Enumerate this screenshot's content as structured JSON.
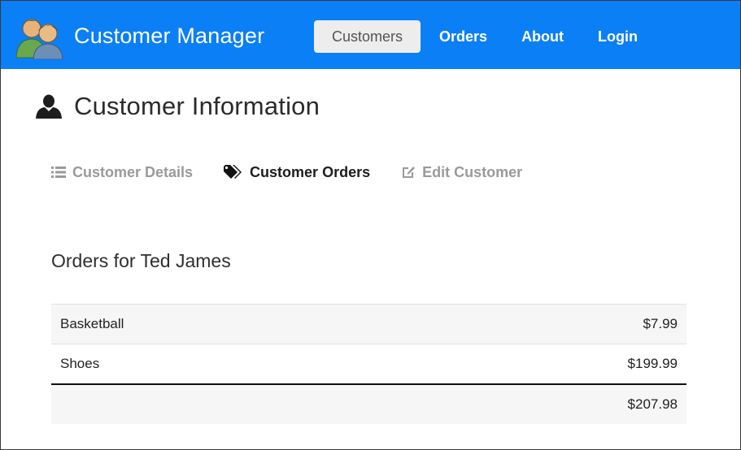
{
  "app": {
    "brand_name": "Customer Manager"
  },
  "nav": {
    "items": [
      {
        "label": "Customers",
        "active": true
      },
      {
        "label": "Orders",
        "active": false
      },
      {
        "label": "About",
        "active": false
      },
      {
        "label": "Login",
        "active": false
      }
    ]
  },
  "page": {
    "title": "Customer Information",
    "title_icon": "user-icon"
  },
  "subtabs": [
    {
      "label": "Customer Details",
      "icon": "list-icon",
      "active": false
    },
    {
      "label": "Customer Orders",
      "icon": "tags-icon",
      "active": true
    },
    {
      "label": "Edit Customer",
      "icon": "edit-icon",
      "active": false
    }
  ],
  "orders": {
    "heading": "Orders for Ted James",
    "rows": [
      {
        "product": "Basketball",
        "price": "$7.99"
      },
      {
        "product": "Shoes",
        "price": "$199.99"
      }
    ],
    "total": "$207.98"
  },
  "colors": {
    "navbar": "#0b7ff5",
    "active_tab_bg": "#ededed",
    "inactive_subtab": "#9a9a9a"
  }
}
